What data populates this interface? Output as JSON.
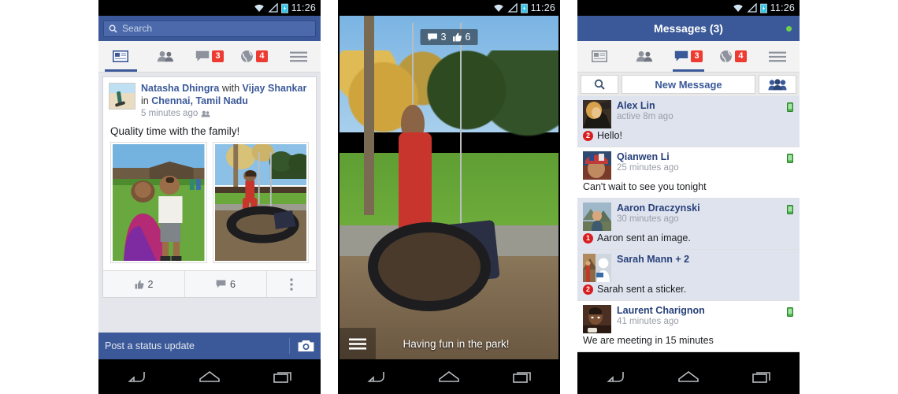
{
  "status_bar": {
    "time": "11:26",
    "icons": [
      "wifi-icon",
      "signal-icon",
      "battery-icon"
    ]
  },
  "colors": {
    "fb_blue": "#3b5998",
    "badge_red": "#ee3b32",
    "count_badge_red": "#d91d1d",
    "online_green": "#6fd34a",
    "unread_row": "#dfe3ee",
    "feed_bg": "#e4e6eb"
  },
  "left_phone": {
    "search": {
      "placeholder": "Search",
      "icon": "search-icon"
    },
    "tabs": [
      {
        "name": "news-feed",
        "icon": "news-feed-icon",
        "badge": "",
        "active": true
      },
      {
        "name": "friends",
        "icon": "friends-icon",
        "badge": "",
        "active": false
      },
      {
        "name": "messages",
        "icon": "messages-icon",
        "badge": "3",
        "active": false
      },
      {
        "name": "notifications",
        "icon": "globe-icon",
        "badge": "4",
        "active": false
      },
      {
        "name": "more",
        "icon": "hamburger-icon",
        "badge": "",
        "active": false
      }
    ],
    "post": {
      "author": "Natasha Dhingra",
      "with_label": "with",
      "tagged": "Vijay Shankar",
      "in_label": "in",
      "place": "Chennai, Tamil Nadu",
      "time": "5 minutes ago",
      "audience_icon": "friends-icon",
      "body": "Quality time with the family!",
      "photos": [
        "photo-mother-and-child",
        "photo-child-on-tire-swing"
      ],
      "actions": {
        "like_icon": "thumbs-up-icon",
        "like_count": "2",
        "comment_icon": "comment-icon",
        "comment_count": "6",
        "more_icon": "overflow-menu-icon"
      }
    },
    "composer": {
      "placeholder": "Post a status update",
      "camera_icon": "camera-icon"
    }
  },
  "middle_phone": {
    "photo": "photo-child-on-tire-swing-fullscreen",
    "overlay": {
      "comment_icon": "comment-icon",
      "comment_count": "3",
      "like_icon": "thumbs-up-icon",
      "like_count": "6"
    },
    "menu_icon": "hamburger-icon",
    "caption": "Having fun in the park!"
  },
  "right_phone": {
    "header": {
      "title": "Messages (3)",
      "status_icon": "online-dot"
    },
    "toolbar": {
      "search_icon": "search-icon",
      "new_message_label": "New Message",
      "group_icon": "group-people-icon"
    },
    "threads": [
      {
        "name": "Alex Lin",
        "time": "active 8m ago",
        "snippet": "Hello!",
        "unread_count": "2",
        "unread": true,
        "mobile_icon": "mobile-online-icon",
        "avatar": "avatar-alex-lin"
      },
      {
        "name": "Qianwen  Li",
        "time": "25 minutes ago",
        "snippet": "Can't wait to see you tonight",
        "unread_count": "",
        "unread": false,
        "mobile_icon": "mobile-online-icon",
        "avatar": "avatar-qianwen-li"
      },
      {
        "name": "Aaron Draczynski",
        "time": "30 minutes ago",
        "snippet": "Aaron sent an image.",
        "unread_count": "1",
        "unread": true,
        "mobile_icon": "mobile-online-icon",
        "avatar": "avatar-aaron-draczynski"
      },
      {
        "name": "Sarah Mann + 2",
        "time": "",
        "snippet": "Sarah sent a sticker.",
        "unread_count": "2",
        "unread": true,
        "mobile_icon": "",
        "avatar": "avatar-sarah-mann-group"
      },
      {
        "name": "Laurent Charignon",
        "time": "41 minutes ago",
        "snippet": "We are meeting in 15 minutes",
        "unread_count": "",
        "unread": false,
        "mobile_icon": "mobile-online-icon",
        "avatar": "avatar-laurent-charignon"
      }
    ]
  },
  "nav_bar": {
    "back_icon": "back-icon",
    "home_icon": "home-icon",
    "recents_icon": "recents-icon"
  }
}
